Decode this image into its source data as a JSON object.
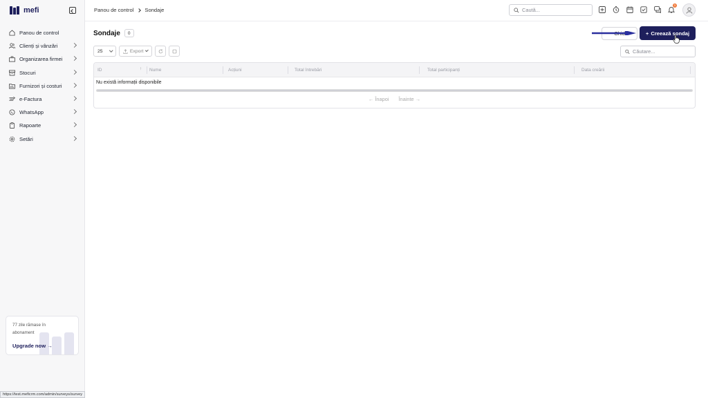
{
  "app": {
    "logo_text": "mefi"
  },
  "sidebar": {
    "items": [
      {
        "label": "Panou de control",
        "icon": "home-icon",
        "has_chevron": false
      },
      {
        "label": "Clienți și vânzări",
        "icon": "users-icon",
        "has_chevron": true
      },
      {
        "label": "Organizarea firmei",
        "icon": "org-icon",
        "has_chevron": true
      },
      {
        "label": "Stocuri",
        "icon": "box-icon",
        "has_chevron": true
      },
      {
        "label": "Furnizori și costuri",
        "icon": "folder-icon",
        "has_chevron": true
      },
      {
        "label": "e-Factura",
        "icon": "efactura-icon",
        "has_chevron": true
      },
      {
        "label": "WhatsApp",
        "icon": "whatsapp-icon",
        "has_chevron": true
      },
      {
        "label": "Rapoarte",
        "icon": "clipboard-icon",
        "has_chevron": true
      },
      {
        "label": "Setări",
        "icon": "gear-icon",
        "has_chevron": true
      }
    ],
    "upgrade": {
      "text": "77 zile rămase în abonament",
      "link": "Upgrade now"
    }
  },
  "header": {
    "breadcrumb": [
      "Panou de control",
      "Sondaje"
    ],
    "search_placeholder": "Caută...",
    "notification_count": "1"
  },
  "main": {
    "title": "Sondaje",
    "count": "0",
    "secondary_button": "Ghid",
    "create_button": "Creează sondaj",
    "page_size": "25",
    "export_label": "Export",
    "table_search_placeholder": "Căutare...",
    "columns": [
      "ID",
      "Nume",
      "Acțiuni",
      "Total întrebări",
      "Total participanți",
      "Data creării"
    ],
    "empty_text": "Nu există informații disponibile",
    "prev_label": "← Înapoi",
    "next_label": "Înainte →"
  },
  "status_url": "https://test.meficrm.com/admin/surveys/survey",
  "colors": {
    "brand": "#1e1f5c",
    "arrow": "#2a2f9e"
  }
}
